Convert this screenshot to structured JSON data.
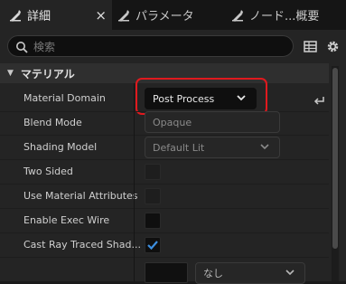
{
  "tabs": [
    {
      "label": "詳細",
      "icon": "details-icon",
      "active": true,
      "close": "×"
    },
    {
      "label": "パラメータ",
      "icon": "parameter-icon",
      "active": false
    },
    {
      "label": "ノード...概要",
      "icon": "node-overview-icon",
      "active": false
    }
  ],
  "search": {
    "placeholder": "検索"
  },
  "toolbar": {
    "grid_icon": "table-view-icon",
    "settings_icon": "gear-icon"
  },
  "section": {
    "title": "マテリアル"
  },
  "rows": [
    {
      "label": "Material Domain",
      "value": "Post Process"
    },
    {
      "label": "Blend Mode",
      "value": "Opaque"
    },
    {
      "label": "Shading Model",
      "value": "Default Lit"
    },
    {
      "label": "Two Sided",
      "checked": false
    },
    {
      "label": "Use Material Attributes",
      "checked": false
    },
    {
      "label": "Enable Exec Wire",
      "checked": false
    },
    {
      "label": "Cast Ray Traced Shad...",
      "checked": true
    },
    {
      "label": "",
      "value": "なし"
    }
  ],
  "colors": {
    "highlight": "#e0191e",
    "check": "#3d8fe0"
  }
}
